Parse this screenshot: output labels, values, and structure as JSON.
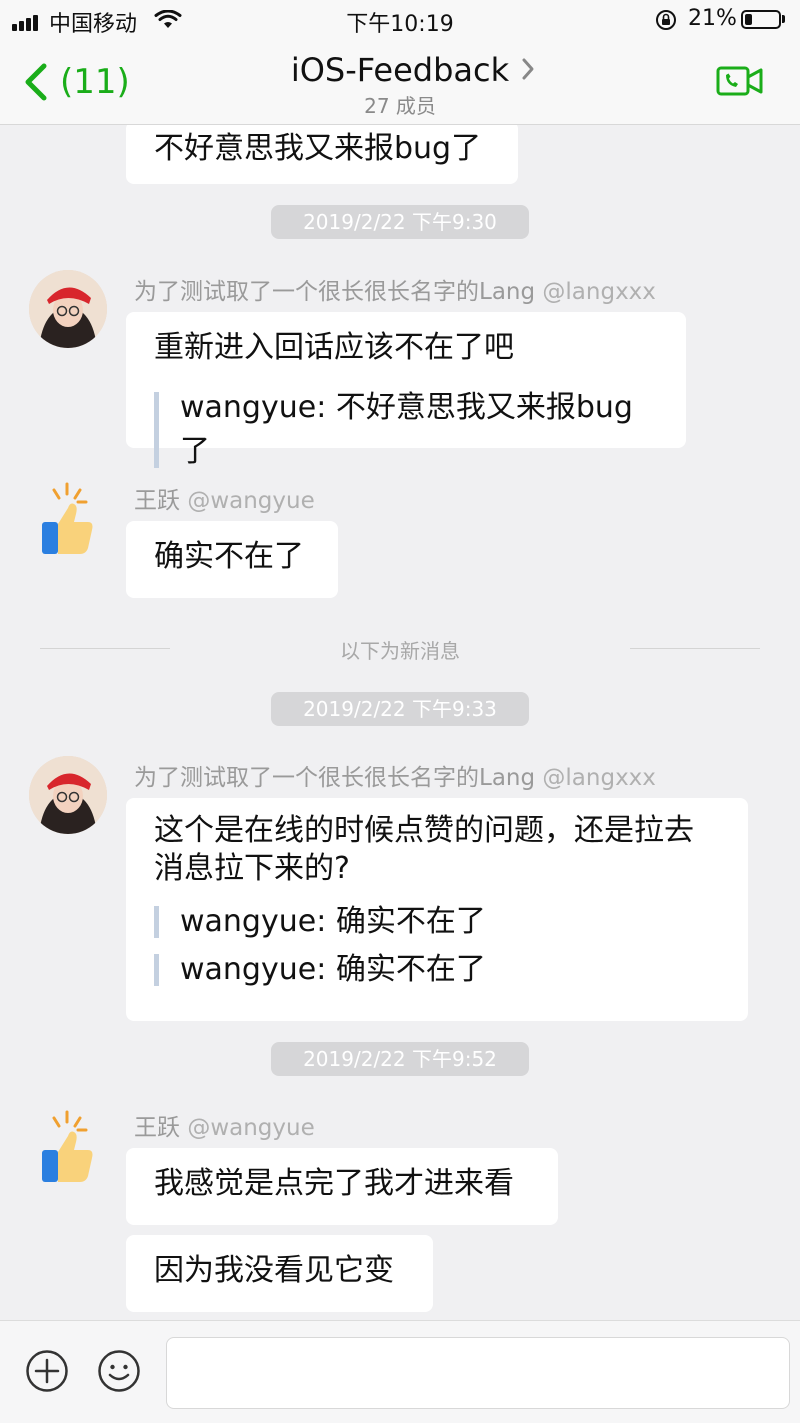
{
  "status_bar": {
    "carrier": "中国移动",
    "time": "下午10:19",
    "battery_percent": "21%",
    "battery_level": 0.21
  },
  "nav": {
    "back_count": "(11)",
    "title": "iOS-Feedback",
    "subtitle": "27 成员"
  },
  "colors": {
    "accent": "#1aad19",
    "bubble": "#ffffff",
    "background": "#f0f0f2",
    "quote_bar": "#c4d0e0"
  },
  "messages": {
    "top_partial": "不好意思我又来报bug了",
    "time1": "2019/2/22 下午9:30",
    "lang1": {
      "name": "为了测试取了一个很长很长名字的Lang",
      "handle": "@langxxx",
      "text": "重新进入回话应该不在了吧",
      "quote": "wangyue: 不好意思我又来报bug了"
    },
    "wang1": {
      "name": "王跃",
      "handle": "@wangyue",
      "text": "确实不在了"
    },
    "new_divider": "以下为新消息",
    "time2": "2019/2/22 下午9:33",
    "lang2": {
      "name": "为了测试取了一个很长很长名字的Lang",
      "handle": "@langxxx",
      "text_line1": "这个是在线的时候点赞的问题，还是拉去",
      "text_line2": "消息拉下来的?",
      "quote1": "wangyue: 确实不在了",
      "quote2": "wangyue: 确实不在了"
    },
    "time3": "2019/2/22 下午9:52",
    "wang2": {
      "name": "王跃",
      "handle": "@wangyue",
      "text1": "我感觉是点完了我才进来看",
      "text2": "因为我没看见它变"
    }
  },
  "icons": {
    "avatar_lang": "girl-photo-avatar",
    "avatar_wang": "thumbs-up-avatar",
    "add": "plus-circle-icon",
    "emoji": "smiley-icon",
    "video": "video-call-icon"
  }
}
